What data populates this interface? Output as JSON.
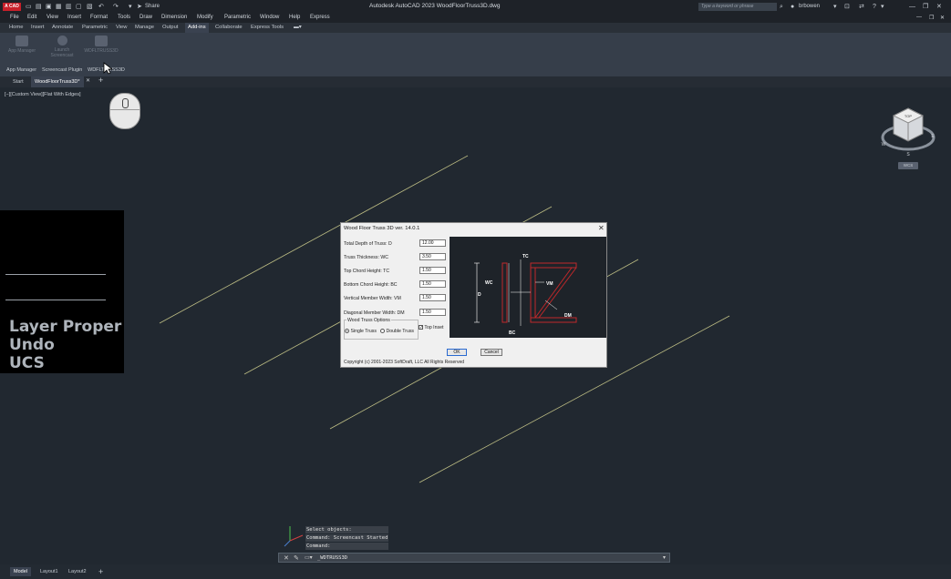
{
  "app": {
    "logo_text": "A CAD",
    "title": "Autodesk AutoCAD 2023    WoodFloorTruss3D.dwg",
    "search_placeholder": "Type a keyword or phrase",
    "user": "brbowen",
    "share_label": "Share"
  },
  "menu": [
    "File",
    "Edit",
    "View",
    "Insert",
    "Format",
    "Tools",
    "Draw",
    "Dimension",
    "Modify",
    "Parametric",
    "Window",
    "Help",
    "Express"
  ],
  "ribbon_tabs": [
    "Home",
    "Insert",
    "Annotate",
    "Parametric",
    "View",
    "Manage",
    "Output",
    "Add-ins",
    "Collaborate",
    "Express Tools"
  ],
  "ribbon_active_tab": "Add-ins",
  "ribbon_buttons": [
    {
      "label": "App Manager"
    },
    {
      "label": "Launch Screencast"
    },
    {
      "label": "WDFLTRUSS3D"
    }
  ],
  "ribbon_panels": [
    "App Manager",
    "Screencast Plugin",
    "WDFLTRUSS3D"
  ],
  "doc_tabs": [
    "Start",
    "WoodFloorTruss3D*"
  ],
  "doc_tab_active": "WoodFloorTruss3D*",
  "view_label": "[−][Custom View][Flat With Edges]",
  "overlay_texts": [
    "Layer Proper",
    "Undo",
    "UCS"
  ],
  "dialog": {
    "title": "Wood Floor Truss 3D ver. 14.0.1",
    "fields": [
      {
        "label": "Total Depth of Truss: D",
        "value": "12.00"
      },
      {
        "label": "Truss Thickness: WC",
        "value": "3.50"
      },
      {
        "label": "Top Chord Height: TC",
        "value": "1.50"
      },
      {
        "label": "Bottom Chord Height: BC",
        "value": "1.50"
      },
      {
        "label": "Vertical Member Width: VM",
        "value": "1.50"
      },
      {
        "label": "Diagonal Member Width: DM",
        "value": "1.50"
      }
    ],
    "options_group": "Wood Truss Options",
    "radio_single": "Single Truss",
    "radio_double": "Double Truss",
    "top_inset": "Top Inset",
    "ok": "OK",
    "cancel": "Cancel",
    "copyright": "Copyright (c) 2001-2023 SoftDraft, LLC All Rights Reserved",
    "diagram_labels": {
      "tc": "TC",
      "wc": "WC",
      "vm": "VM",
      "d": "D",
      "dm": "DM",
      "bc": "BC"
    }
  },
  "command_history": [
    "Select objects:",
    "Command: Screencast Started",
    "Command:"
  ],
  "command_input": "_WDTRUSS3D",
  "layout_tabs": [
    "Model",
    "Layout1",
    "Layout2"
  ],
  "layout_active": "Model",
  "viewcube": {
    "face": "TOP",
    "wcs": "WCS",
    "compass": [
      "N",
      "E",
      "S",
      "W"
    ]
  },
  "colors": {
    "background": "#212830",
    "accent_red": "#c8202a",
    "lines": "#c9c98a"
  }
}
